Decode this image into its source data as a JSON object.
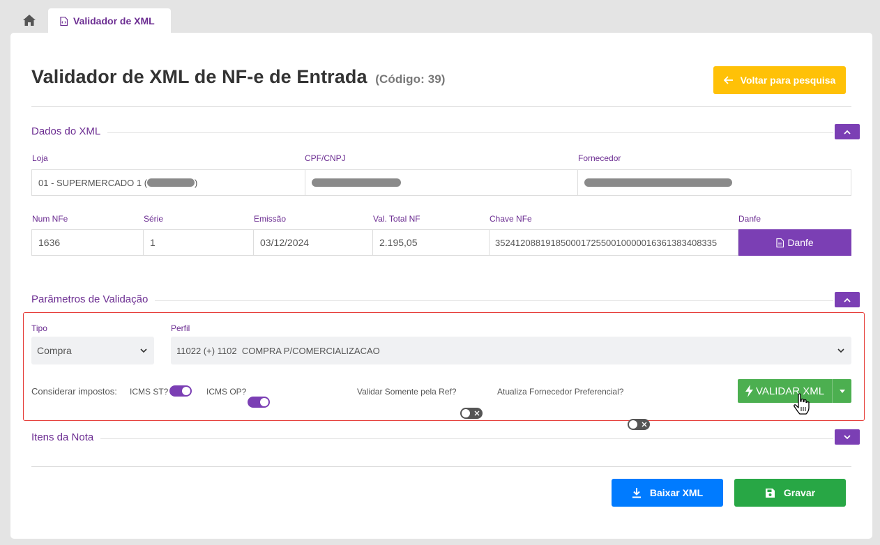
{
  "tabs": {
    "active_label": "Validador de XML"
  },
  "header": {
    "title": "Validador de XML de NF-e de Entrada",
    "code": "(Código: 39)",
    "back_label": "Voltar para pesquisa"
  },
  "dados": {
    "section_title": "Dados do XML",
    "loja_label": "Loja",
    "loja_prefix": "01 - SUPERMERCADO 1 (",
    "loja_suffix": ")",
    "cpf_label": "CPF/CNPJ",
    "fornecedor_label": "Fornecedor",
    "num_label": "Num NFe",
    "num_value": "1636",
    "serie_label": "Série",
    "serie_value": "1",
    "emissao_label": "Emissão",
    "emissao_value": "03/12/2024",
    "total_label": "Val. Total NF",
    "total_value": "2.195,05",
    "chave_label": "Chave NFe",
    "chave_value": "35241208819185000172550010000016361383408335",
    "danfe_label": "Danfe",
    "danfe_button": "Danfe"
  },
  "params": {
    "section_title": "Parâmetros de Validação",
    "tipo_label": "Tipo",
    "tipo_value": "Compra",
    "perfil_label": "Perfil",
    "perfil_value": "11022 (+) 1102  COMPRA P/COMERCIALIZACAO",
    "considerar_label": "Considerar impostos:",
    "icms_st_label": "ICMS ST?",
    "icms_op_label": "ICMS OP?",
    "validar_ref_label": "Validar Somente pela Ref?",
    "atualiza_label": "Atualiza Fornecedor Preferencial?",
    "validar_button": "VALIDAR XML",
    "switches": {
      "icms_st": true,
      "icms_op": true,
      "validar_ref": false,
      "atualiza": false
    }
  },
  "itens": {
    "section_title": "Itens da Nota"
  },
  "footer": {
    "baixar_label": "Baixar XML",
    "gravar_label": "Gravar"
  },
  "colors": {
    "accent": "#7b3fb4",
    "warning": "#ffc107",
    "success": "#4caf50",
    "primary": "#007bff",
    "save": "#28a745",
    "highlight": "#e53935"
  }
}
